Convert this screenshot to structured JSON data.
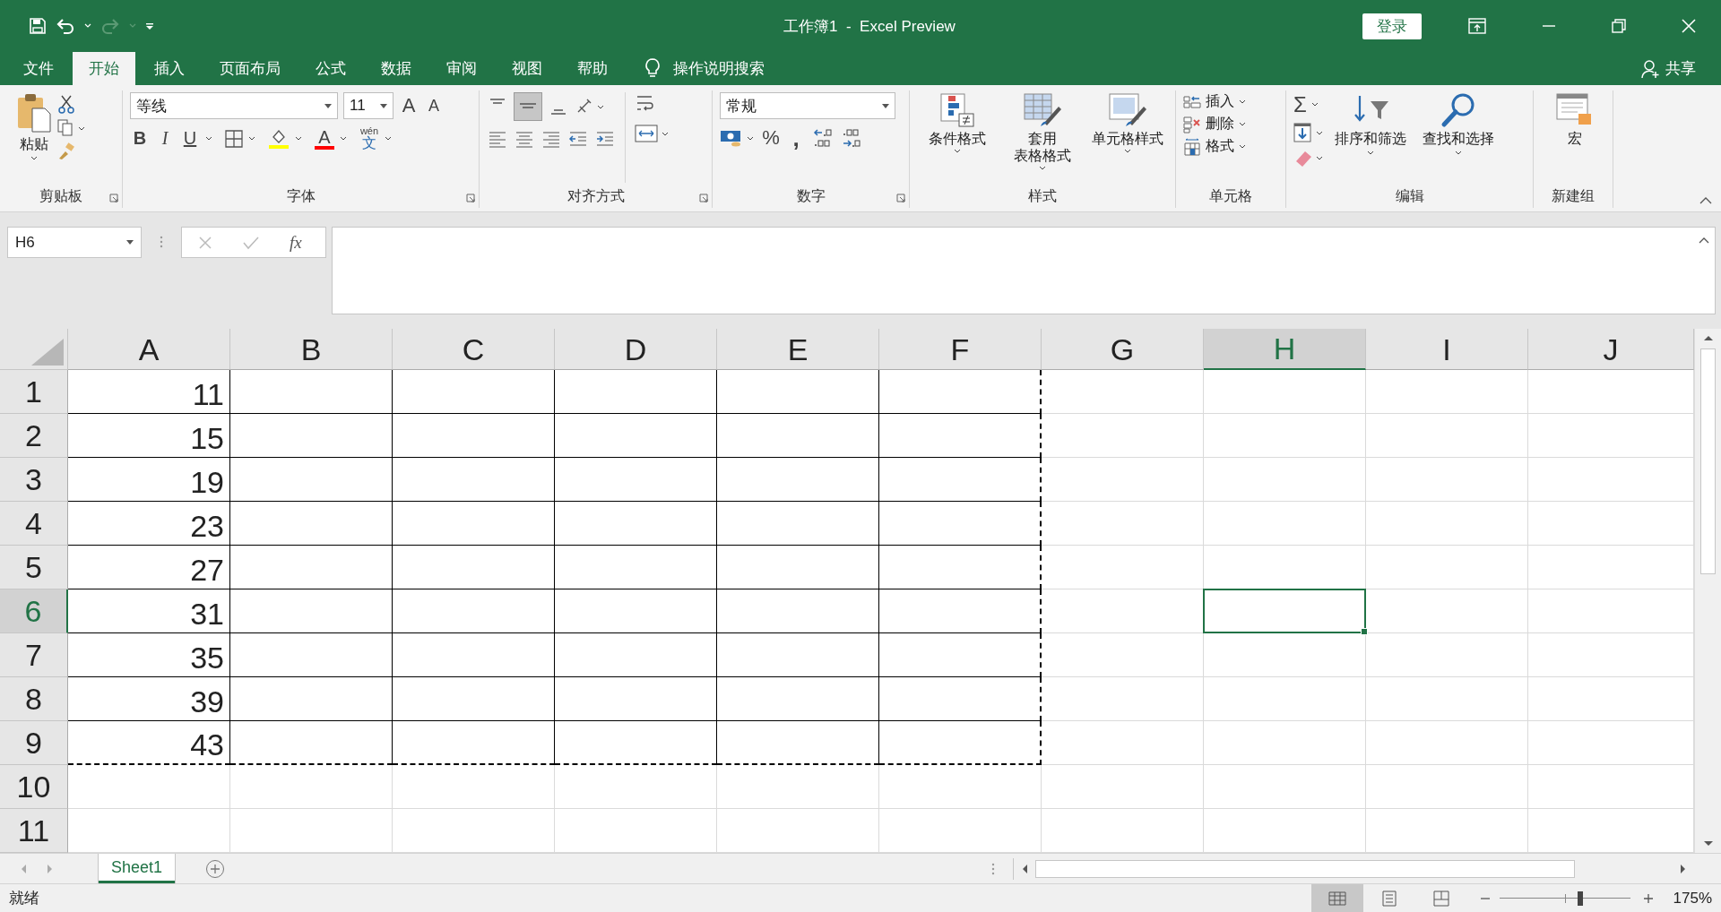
{
  "title_bar": {
    "title": "工作簿1  -  Excel Preview",
    "sign_in": "登录"
  },
  "tabs": [
    {
      "label": "文件",
      "selected": false
    },
    {
      "label": "开始",
      "selected": true
    },
    {
      "label": "插入",
      "selected": false
    },
    {
      "label": "页面布局",
      "selected": false
    },
    {
      "label": "公式",
      "selected": false
    },
    {
      "label": "数据",
      "selected": false
    },
    {
      "label": "审阅",
      "selected": false
    },
    {
      "label": "视图",
      "selected": false
    },
    {
      "label": "帮助",
      "selected": false
    }
  ],
  "tell_me": "操作说明搜索",
  "share": "共享",
  "ribbon": {
    "clipboard": {
      "paste": "粘贴",
      "label": "剪贴板"
    },
    "font": {
      "font_name": "等线",
      "font_size": "11",
      "grow": "A",
      "shrink": "A",
      "bold": "B",
      "italic": "I",
      "underline": "U",
      "font_color": "A",
      "phonetic_top": "wén",
      "phonetic_bottom": "文",
      "label": "字体"
    },
    "alignment": {
      "label": "对齐方式"
    },
    "number": {
      "format": "常规",
      "percent": "%",
      "comma": ",",
      "label": "数字"
    },
    "styles": {
      "buttons": [
        {
          "lines": [
            "条件格式"
          ],
          "kind": "conditional"
        },
        {
          "lines": [
            "套用",
            "表格格式"
          ],
          "kind": "table"
        },
        {
          "lines": [
            "单元格样式"
          ],
          "kind": "cellstyle"
        }
      ],
      "label": "样式"
    },
    "cells": {
      "buttons": [
        {
          "label": "插入",
          "kind": "insert"
        },
        {
          "label": "删除",
          "kind": "delete"
        },
        {
          "label": "格式",
          "kind": "format"
        }
      ],
      "label": "单元格"
    },
    "editing": {
      "sigma": "Σ",
      "buttons": [
        {
          "label": "排序和筛选",
          "kind": "sort"
        },
        {
          "label": "查找和选择",
          "kind": "find"
        }
      ],
      "label": "编辑"
    },
    "new_group": {
      "button": "宏",
      "label": "新建组"
    }
  },
  "formula_bar": {
    "name_box": "H6",
    "fx": "fx"
  },
  "sheet": {
    "columns": [
      {
        "label": "A",
        "selected": false,
        "bordered": true
      },
      {
        "label": "B",
        "selected": false,
        "bordered": true
      },
      {
        "label": "C",
        "selected": false,
        "bordered": true
      },
      {
        "label": "D",
        "selected": false,
        "bordered": true
      },
      {
        "label": "E",
        "selected": false,
        "bordered": true
      },
      {
        "label": "F",
        "selected": false,
        "bordered": true
      },
      {
        "label": "G",
        "selected": false,
        "bordered": false
      },
      {
        "label": "H",
        "selected": true,
        "bordered": false
      },
      {
        "label": "I",
        "selected": false,
        "bordered": false
      },
      {
        "label": "J",
        "selected": false,
        "bordered": false
      }
    ],
    "rows": [
      {
        "label": "1",
        "selected": false,
        "bordered": true,
        "cells": [
          "11"
        ]
      },
      {
        "label": "2",
        "selected": false,
        "bordered": true,
        "cells": [
          "15"
        ]
      },
      {
        "label": "3",
        "selected": false,
        "bordered": true,
        "cells": [
          "19"
        ]
      },
      {
        "label": "4",
        "selected": false,
        "bordered": true,
        "cells": [
          "23"
        ]
      },
      {
        "label": "5",
        "selected": false,
        "bordered": true,
        "cells": [
          "27"
        ]
      },
      {
        "label": "6",
        "selected": true,
        "bordered": true,
        "cells": [
          "31"
        ]
      },
      {
        "label": "7",
        "selected": false,
        "bordered": true,
        "cells": [
          "35"
        ]
      },
      {
        "label": "8",
        "selected": false,
        "bordered": true,
        "cells": [
          "39"
        ]
      },
      {
        "label": "9",
        "selected": false,
        "bordered": true,
        "cells": [
          "43"
        ]
      },
      {
        "label": "10",
        "selected": false,
        "bordered": false
      },
      {
        "label": "11",
        "selected": false,
        "bordered": false
      }
    ]
  },
  "sheet_tabs": [
    {
      "label": "Sheet1",
      "selected": true
    }
  ],
  "status_bar": {
    "text": "就绪",
    "views": [
      {
        "kind": "normal",
        "selected": true
      },
      {
        "kind": "page_layout",
        "selected": false
      },
      {
        "kind": "page_break",
        "selected": false
      }
    ],
    "zoom_slider": {
      "level": 0.62
    },
    "zoom": "175%"
  }
}
